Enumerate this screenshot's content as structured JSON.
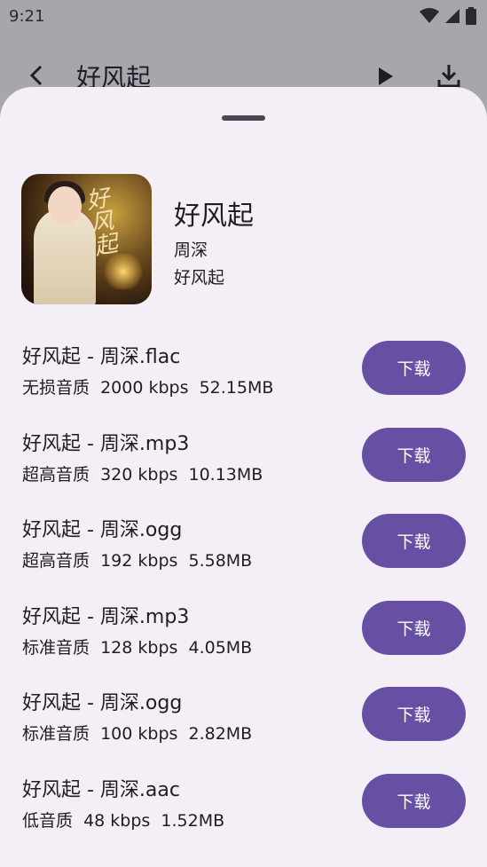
{
  "status_bar": {
    "time": "9:21"
  },
  "app_bar": {
    "title": "好风起"
  },
  "song": {
    "title": "好风起",
    "artist": "周深",
    "album": "好风起"
  },
  "download_label": "下载",
  "files": [
    {
      "name": "好风起 - 周深.flac",
      "info": "无损音质  2000 kbps  52.15MB"
    },
    {
      "name": "好风起 - 周深.mp3",
      "info": "超高音质  320 kbps  10.13MB"
    },
    {
      "name": "好风起 - 周深.ogg",
      "info": "超高音质  192 kbps  5.58MB"
    },
    {
      "name": "好风起 - 周深.mp3",
      "info": "标准音质  128 kbps  4.05MB"
    },
    {
      "name": "好风起 - 周深.ogg",
      "info": "标准音质  100 kbps  2.82MB"
    },
    {
      "name": "好风起 - 周深.aac",
      "info": "低音质  48 kbps  1.52MB"
    }
  ],
  "colors": {
    "accent": "#6750a4",
    "sheet_bg": "#f4eff7",
    "scrim": "#a8a6ad"
  },
  "icons": [
    "back-icon",
    "play-icon",
    "download-icon",
    "wifi-icon",
    "signal-icon",
    "battery-icon"
  ]
}
